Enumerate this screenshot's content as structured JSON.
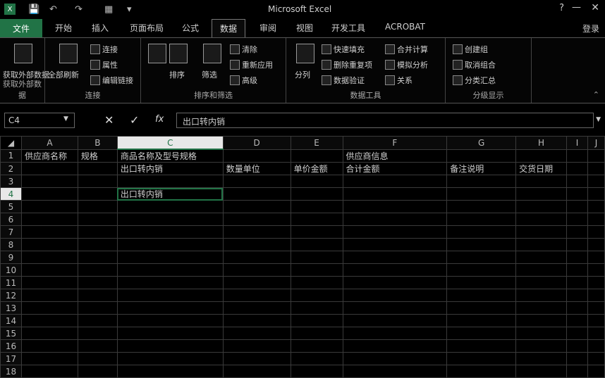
{
  "titlebar": {
    "title": "Microsoft Excel",
    "help": "?",
    "minimize": "—",
    "close": "✕"
  },
  "tabs": {
    "file": "文件",
    "items": [
      "开始",
      "插入",
      "页面布局",
      "公式",
      "数据",
      "审阅",
      "视图",
      "开发工具",
      "ACROBAT"
    ],
    "active": "数据",
    "account": "登录"
  },
  "ribbon": {
    "groups": [
      {
        "label": "获取外部数据",
        "buttons": [
          "获取外部数据"
        ]
      },
      {
        "label": "连接",
        "buttons": [
          "全部刷新",
          "连接",
          "属性",
          "编辑链接"
        ]
      },
      {
        "label": "排序和筛选",
        "buttons": [
          "排序",
          "筛选",
          "清除",
          "重新应用",
          "高级"
        ]
      },
      {
        "label": "数据工具",
        "buttons": [
          "分列",
          "快速填充",
          "删除重复项",
          "数据验证",
          "合并计算",
          "模拟分析",
          "关系"
        ]
      },
      {
        "label": "分级显示",
        "buttons": [
          "创建组",
          "取消组合",
          "分类汇总"
        ]
      }
    ]
  },
  "formula_bar": {
    "name_box": "C4",
    "cancel": "✕",
    "enter": "✓",
    "insert_function": "fx",
    "value": "出口转内销"
  },
  "columns": [
    "A",
    "B",
    "C",
    "D",
    "E",
    "F",
    "G",
    "H",
    "I",
    "J"
  ],
  "active_column": "C",
  "active_row": 4,
  "rows": [
    {
      "n": 1,
      "cells": [
        "供应商名称",
        "规格",
        "商品名称及型号规格",
        "",
        "",
        "供应商信息",
        "",
        "",
        "",
        ""
      ]
    },
    {
      "n": 2,
      "cells": [
        "",
        "",
        "出口转内销",
        "数量单位",
        "单价金额",
        "合计金额",
        "备注说明",
        "交货日期",
        "",
        ""
      ]
    },
    {
      "n": 3,
      "cells": [
        "",
        "",
        "",
        "",
        "",
        "",
        "",
        "",
        "",
        ""
      ]
    },
    {
      "n": 4,
      "cells": [
        "",
        "",
        "出口转内销",
        "",
        "",
        "",
        "",
        "",
        "",
        ""
      ]
    },
    {
      "n": 5,
      "cells": [
        "",
        "",
        "",
        "",
        "",
        "",
        "",
        "",
        "",
        ""
      ]
    },
    {
      "n": 6,
      "cells": [
        "",
        "",
        "",
        "",
        "",
        "",
        "",
        "",
        "",
        ""
      ]
    },
    {
      "n": 7,
      "cells": [
        "",
        "",
        "",
        "",
        "",
        "",
        "",
        "",
        "",
        ""
      ]
    },
    {
      "n": 8,
      "cells": [
        "",
        "",
        "",
        "",
        "",
        "",
        "",
        "",
        "",
        ""
      ]
    },
    {
      "n": 9,
      "cells": [
        "",
        "",
        "",
        "",
        "",
        "",
        "",
        "",
        "",
        ""
      ]
    },
    {
      "n": 10,
      "cells": [
        "",
        "",
        "",
        "",
        "",
        "",
        "",
        "",
        "",
        ""
      ]
    },
    {
      "n": 11,
      "cells": [
        "",
        "",
        "",
        "",
        "",
        "",
        "",
        "",
        "",
        ""
      ]
    },
    {
      "n": 12,
      "cells": [
        "",
        "",
        "",
        "",
        "",
        "",
        "",
        "",
        "",
        ""
      ]
    },
    {
      "n": 13,
      "cells": [
        "",
        "",
        "",
        "",
        "",
        "",
        "",
        "",
        "",
        ""
      ]
    },
    {
      "n": 14,
      "cells": [
        "",
        "",
        "",
        "",
        "",
        "",
        "",
        "",
        "",
        ""
      ]
    },
    {
      "n": 15,
      "cells": [
        "",
        "",
        "",
        "",
        "",
        "",
        "",
        "",
        "",
        ""
      ]
    },
    {
      "n": 16,
      "cells": [
        "",
        "",
        "",
        "",
        "",
        "",
        "",
        "",
        "",
        ""
      ]
    },
    {
      "n": 17,
      "cells": [
        "",
        "",
        "",
        "",
        "",
        "",
        "",
        "",
        "",
        ""
      ]
    },
    {
      "n": 18,
      "cells": [
        "",
        "",
        "",
        "",
        "",
        "",
        "",
        "",
        "",
        ""
      ]
    }
  ],
  "colors": {
    "accent": "#217346",
    "background": "#000000"
  }
}
